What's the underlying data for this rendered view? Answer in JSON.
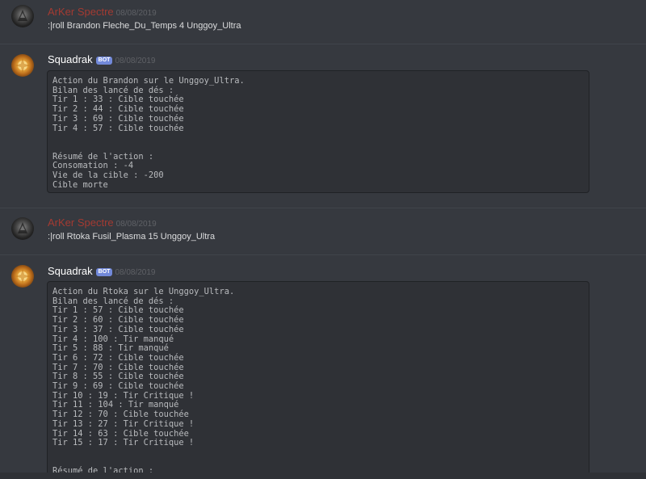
{
  "messages": [
    {
      "author": "ArKer Spectre",
      "timestamp": "08/08/2019",
      "content": ":|roll Brandon Fleche_Du_Temps 4 Unggoy_Ultra"
    },
    {
      "author": "Squadrak",
      "bot_tag": "BOT",
      "timestamp": "08/08/2019",
      "code": "Action du Brandon sur le Unggoy_Ultra.\nBilan des lancé de dés :\nTir 1 : 33 : Cible touchée\nTir 2 : 44 : Cible touchée\nTir 3 : 69 : Cible touchée\nTir 4 : 57 : Cible touchée\n\n\nRésumé de l'action :\nConsomation : -4\nVie de la cible : -200\nCible morte"
    },
    {
      "author": "ArKer Spectre",
      "timestamp": "08/08/2019",
      "content": ":|roll Rtoka Fusil_Plasma 15 Unggoy_Ultra"
    },
    {
      "author": "Squadrak",
      "bot_tag": "BOT",
      "timestamp": "08/08/2019",
      "code": "Action du Rtoka sur le Unggoy_Ultra.\nBilan des lancé de dés :\nTir 1 : 57 : Cible touchée\nTir 2 : 60 : Cible touchée\nTir 3 : 37 : Cible touchée\nTir 4 : 100 : Tir manqué\nTir 5 : 88 : Tir manqué\nTir 6 : 72 : Cible touchée\nTir 7 : 70 : Cible touchée\nTir 8 : 55 : Cible touchée\nTir 9 : 69 : Cible touchée\nTir 10 : 19 : Tir Critique !\nTir 11 : 104 : Tir manqué\nTir 12 : 70 : Cible touchée\nTir 13 : 27 : Tir Critique !\nTir 14 : 63 : Cible touchée\nTir 15 : 17 : Tir Critique !\n\n\nRésumé de l'action :"
    }
  ],
  "colors": {
    "background": "#36393f",
    "codeblock_bg": "#2f3136",
    "spectre_name": "#a33a32",
    "bot_tag": "#7289da"
  },
  "icons": {
    "spectre_avatar": "dark-helmet-avatar-icon",
    "squadrak_avatar": "golden-emblem-avatar-icon"
  }
}
